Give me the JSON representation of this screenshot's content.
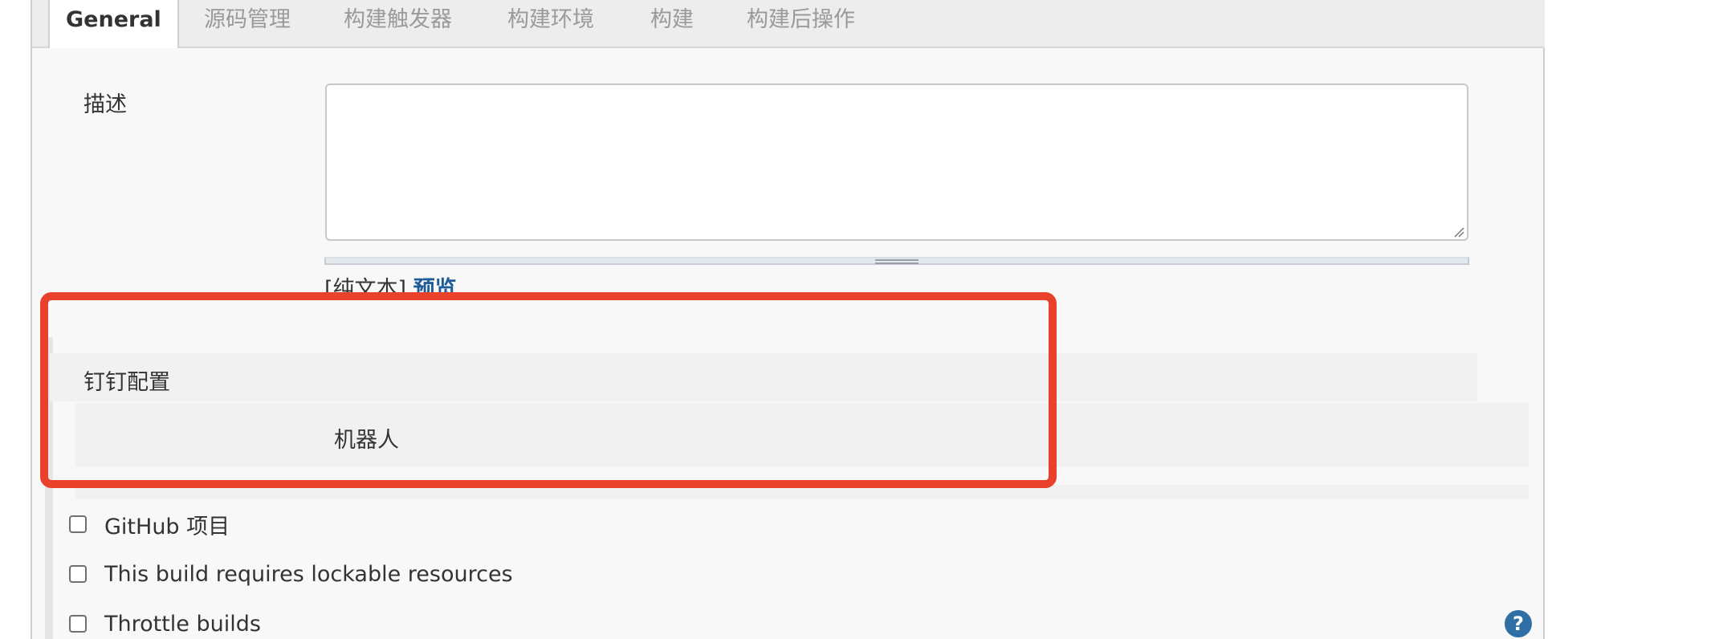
{
  "tabs": [
    {
      "label": "General",
      "active": true
    },
    {
      "label": "源码管理",
      "active": false
    },
    {
      "label": "构建触发器",
      "active": false
    },
    {
      "label": "构建环境",
      "active": false
    },
    {
      "label": "构建",
      "active": false
    },
    {
      "label": "构建后操作",
      "active": false
    }
  ],
  "description": {
    "label": "描述",
    "value": "",
    "format_prefix": "[纯文本]",
    "preview_link": "预览"
  },
  "dingtalk": {
    "section_title": "钉钉配置",
    "robot_label": "机器人"
  },
  "options": [
    {
      "label": "GitHub 项目",
      "checked": false
    },
    {
      "label": "This build requires lockable resources",
      "checked": false
    },
    {
      "label": "Throttle builds",
      "checked": false
    }
  ],
  "help": {
    "glyph": "?"
  },
  "colors": {
    "highlight": "#e8412c",
    "link": "#1f5d99",
    "help_icon": "#2f6fa6"
  }
}
